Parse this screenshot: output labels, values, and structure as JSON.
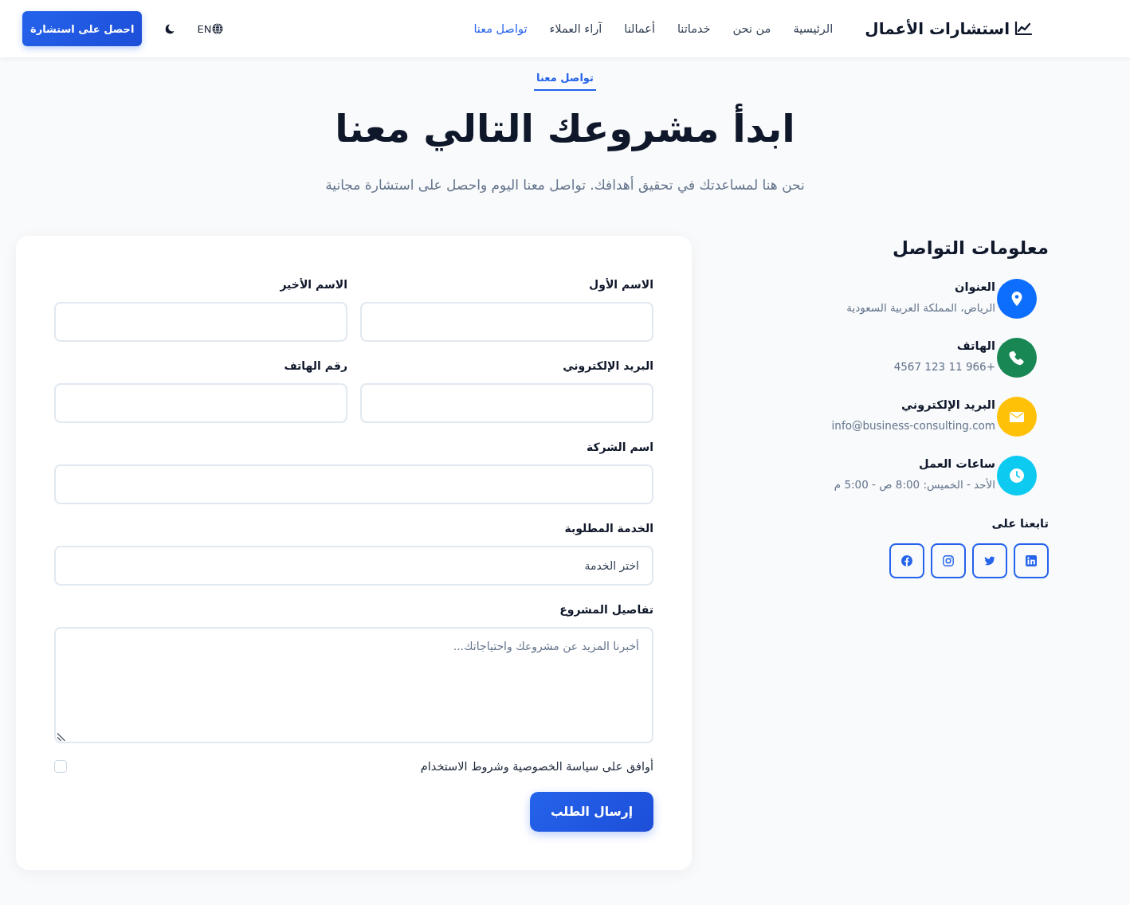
{
  "header": {
    "brand": "استشارات الأعمال",
    "nav": [
      {
        "label": "الرئيسية",
        "selected": false
      },
      {
        "label": "من نحن",
        "selected": false
      },
      {
        "label": "خدماتنا",
        "selected": false
      },
      {
        "label": "أعمالنا",
        "selected": false
      },
      {
        "label": "آراء العملاء",
        "selected": false
      },
      {
        "label": "تواصل معنا",
        "selected": true
      }
    ],
    "language": "EN",
    "cta": "احصل على استشارة"
  },
  "hero": {
    "badge": "تواصل معنا",
    "title": "ابدأ مشروعك التالي معنا",
    "subtitle": "نحن هنا لمساعدتك في تحقيق أهدافك. تواصل معنا اليوم واحصل على استشارة مجانية"
  },
  "contact_info": {
    "title": "معلومات التواصل",
    "items": [
      {
        "kind": "address",
        "label": "العنوان",
        "value": "الرياض، المملكة العربية السعودية",
        "color": "#0d6efd"
      },
      {
        "kind": "phone",
        "label": "الهاتف",
        "value": "+966 11 123 4567",
        "color": "#198754"
      },
      {
        "kind": "email",
        "label": "البريد الإلكتروني",
        "value": "info@business-consulting.com",
        "color": "#ffc107"
      },
      {
        "kind": "hours",
        "label": "ساعات العمل",
        "value": "الأحد - الخميس: 8:00 ص - 5:00 م",
        "color": "#0dcaf0"
      }
    ],
    "follow_title": "تابعنا على"
  },
  "form": {
    "rows": [
      {
        "fields": [
          {
            "kind": "input",
            "label": "الاسم الأول"
          },
          {
            "kind": "input",
            "label": "الاسم الأخير"
          }
        ]
      },
      {
        "fields": [
          {
            "kind": "input",
            "label": "البريد الإلكتروني"
          },
          {
            "kind": "input",
            "label": "رقم الهاتف"
          }
        ]
      },
      {
        "fields": [
          {
            "kind": "input",
            "label": "اسم الشركة"
          }
        ]
      },
      {
        "fields": [
          {
            "kind": "select",
            "label": "الخدمة المطلوبة",
            "value": "اختر الخدمة"
          }
        ]
      },
      {
        "fields": [
          {
            "kind": "textarea",
            "label": "تفاصيل المشروع",
            "placeholder": "أخبرنا المزيد عن مشروعك واحتياجاتك..."
          }
        ]
      }
    ],
    "agreement": {
      "label": "أوافق على سياسة الخصوصية وشروط الاستخدام",
      "checked": false
    },
    "submit": "إرسال الطلب"
  }
}
